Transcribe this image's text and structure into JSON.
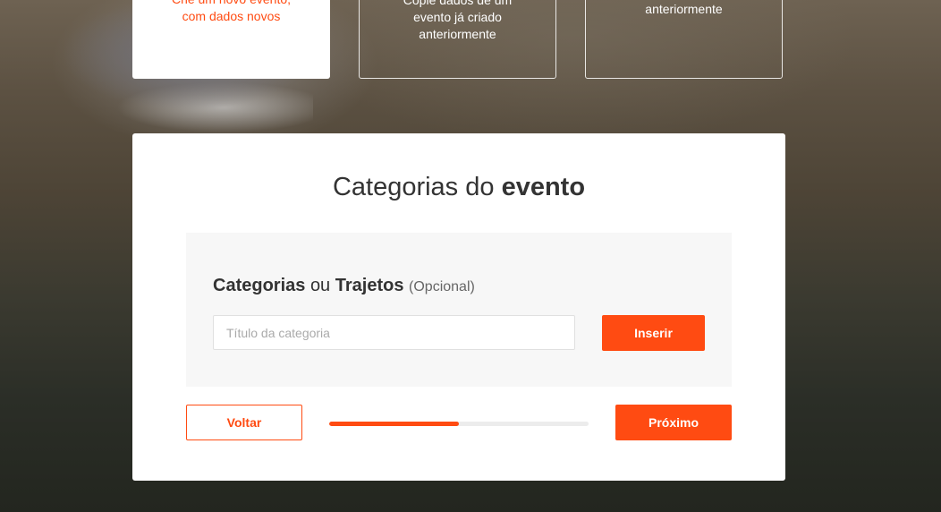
{
  "options": [
    {
      "text": "Crie um novo evento, com dados novos",
      "active": true
    },
    {
      "text": "Copie dados de um evento já criado anteriormente",
      "active": false
    },
    {
      "text": "anteriormente",
      "active": false
    }
  ],
  "section": {
    "title_light": "Categorias do",
    "title_bold": "evento"
  },
  "categories": {
    "label_bold1": "Categorias",
    "label_or": "ou",
    "label_bold2": "Trajetos",
    "label_optional": "(Opcional)",
    "input_placeholder": "Título da categoria",
    "input_value": "",
    "insert_label": "Inserir"
  },
  "nav": {
    "back_label": "Voltar",
    "next_label": "Próximo",
    "progress": 0.5
  },
  "colors": {
    "accent": "#ff4b12",
    "panel_bg": "#f7f7f7"
  }
}
